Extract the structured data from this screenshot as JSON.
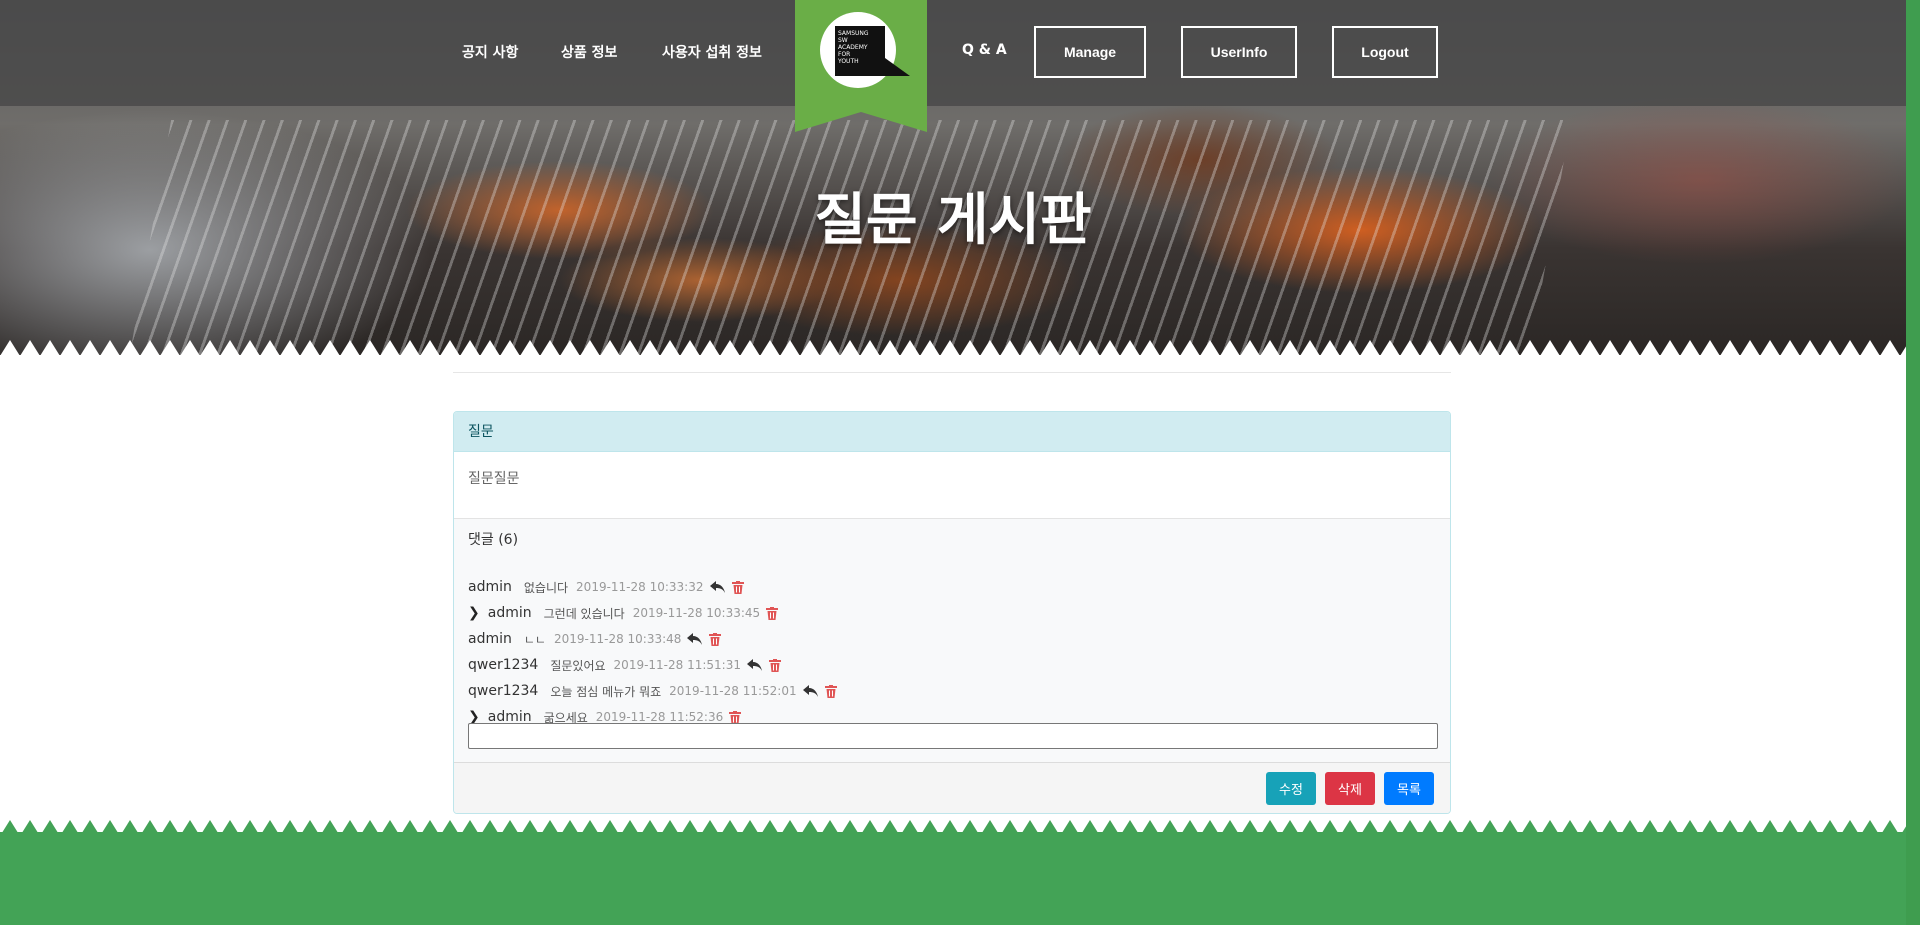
{
  "nav": {
    "links": [
      "공지 사항",
      "상품 정보",
      "사용자 섭취 정보",
      "Q & A"
    ],
    "buttons": [
      "Manage",
      "UserInfo",
      "Logout"
    ],
    "logo_text": [
      "SAMSUNG",
      "SW",
      "ACADEMY",
      "FOR",
      "YOUTH"
    ]
  },
  "hero": {
    "title": "질문 게시판"
  },
  "post": {
    "title": "질문",
    "body": "질문질문",
    "comments_label": "댓글 (6)",
    "comments": [
      {
        "reply": false,
        "author": "admin",
        "text": "없습니다",
        "time": "2019-11-28 10:33:32",
        "can_reply": true
      },
      {
        "reply": true,
        "author": "admin",
        "text": "그런데 있습니다",
        "time": "2019-11-28 10:33:45",
        "can_reply": false
      },
      {
        "reply": false,
        "author": "admin",
        "text": "ㄴㄴ",
        "time": "2019-11-28 10:33:48",
        "can_reply": true
      },
      {
        "reply": false,
        "author": "qwer1234",
        "text": "질문있어요",
        "time": "2019-11-28 11:51:31",
        "can_reply": true
      },
      {
        "reply": false,
        "author": "qwer1234",
        "text": "오늘 점심 메뉴가 뭐죠",
        "time": "2019-11-28 11:52:01",
        "can_reply": true
      },
      {
        "reply": true,
        "author": "admin",
        "text": "굶으세요",
        "time": "2019-11-28 11:52:36",
        "can_reply": false
      }
    ],
    "comment_input_value": ""
  },
  "actions": {
    "edit": "수정",
    "delete": "삭제",
    "list": "목록"
  },
  "colors": {
    "accent_green": "#43a356",
    "edit_btn": "#17a2b8",
    "delete_btn": "#dc3545",
    "list_btn": "#007bff",
    "trash_red": "#e05555"
  },
  "icons": [
    "chevron-right-icon",
    "reply-icon",
    "trash-icon"
  ]
}
